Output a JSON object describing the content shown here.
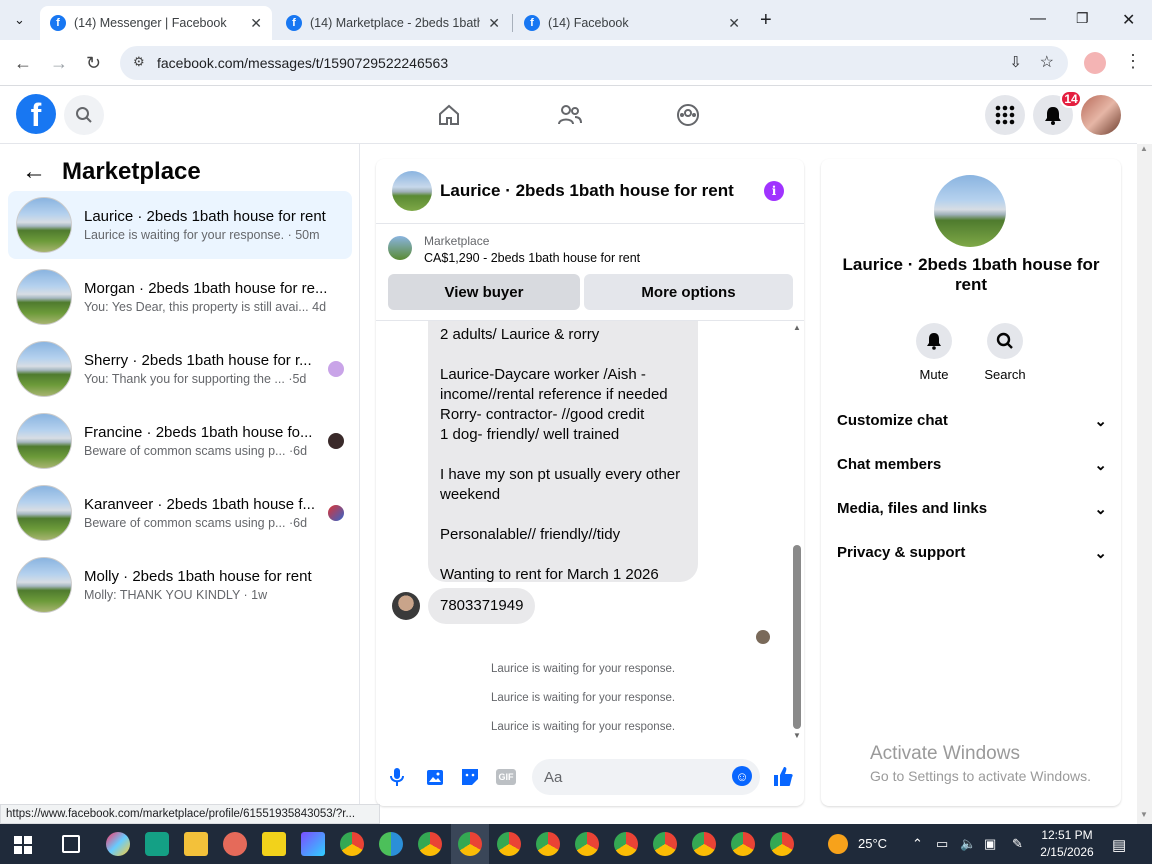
{
  "browser": {
    "tabs": [
      {
        "title": "(14) Messenger | Facebook"
      },
      {
        "title": "(14) Marketplace - 2beds 1bath"
      },
      {
        "title": "(14) Facebook"
      }
    ],
    "url": "facebook.com/messages/t/1590729522246563",
    "status_url": "https://www.facebook.com/marketplace/profile/61551935843053/?r..."
  },
  "header": {
    "notification_count": "14"
  },
  "sidebar": {
    "title": "Marketplace",
    "items": [
      {
        "title": "Laurice · 2beds 1bath house for rent",
        "preview": "Laurice is waiting for your response.",
        "time": "50m"
      },
      {
        "title": "Morgan · 2beds 1bath house for re...",
        "preview": "You: Yes Dear, this property is still avai...",
        "time": "4d"
      },
      {
        "title": "Sherry · 2beds 1bath house for r...",
        "preview": "You: Thank you for supporting the ...",
        "time": "5d"
      },
      {
        "title": "Francine · 2beds 1bath house fo...",
        "preview": "Beware of common scams using p...",
        "time": "6d"
      },
      {
        "title": "Karanveer · 2beds 1bath house f...",
        "preview": "Beware of common scams using p...",
        "time": "6d"
      },
      {
        "title": "Molly · 2beds 1bath house for rent",
        "preview": "Molly: THANK YOU KINDLY",
        "time": "1w"
      }
    ]
  },
  "chat": {
    "title": "Laurice · 2beds 1bath house for rent",
    "marketplace_label": "Marketplace",
    "listing": "CA$1,290 - 2beds 1bath house for rent",
    "view_buyer": "View buyer",
    "more_options": "More options",
    "message_lines": [
      "2 adults/ Laurice & rorry",
      "",
      "Laurice-Daycare worker /Aish -",
      "income//rental reference if needed",
      "Rorry- contractor- //good credit",
      "1 dog- friendly/ well trained",
      "",
      "I have my son pt  usually every other",
      "weekend",
      "",
      "Personalable// friendly//tidy",
      "",
      "Wanting to rent for March 1 2026"
    ],
    "phone_message": "7803371949",
    "system_messages": [
      "Laurice is waiting for your response.",
      "Laurice is waiting for your response.",
      "Laurice is waiting for your response."
    ],
    "composer_placeholder": "Aa"
  },
  "details": {
    "title": "Laurice · 2beds 1bath house for rent",
    "mute": "Mute",
    "search": "Search",
    "sections": [
      "Customize chat",
      "Chat members",
      "Media, files and links",
      "Privacy & support"
    ]
  },
  "activate": {
    "line1": "Activate Windows",
    "line2": "Go to Settings to activate Windows."
  },
  "taskbar": {
    "weather": "25°C",
    "time": "12:51 PM",
    "date": "2/15/2026"
  },
  "colors": {
    "brand": "#1877f2",
    "accent": "#0866ff",
    "selected": "#ebf5ff",
    "info": "#a033ff"
  }
}
